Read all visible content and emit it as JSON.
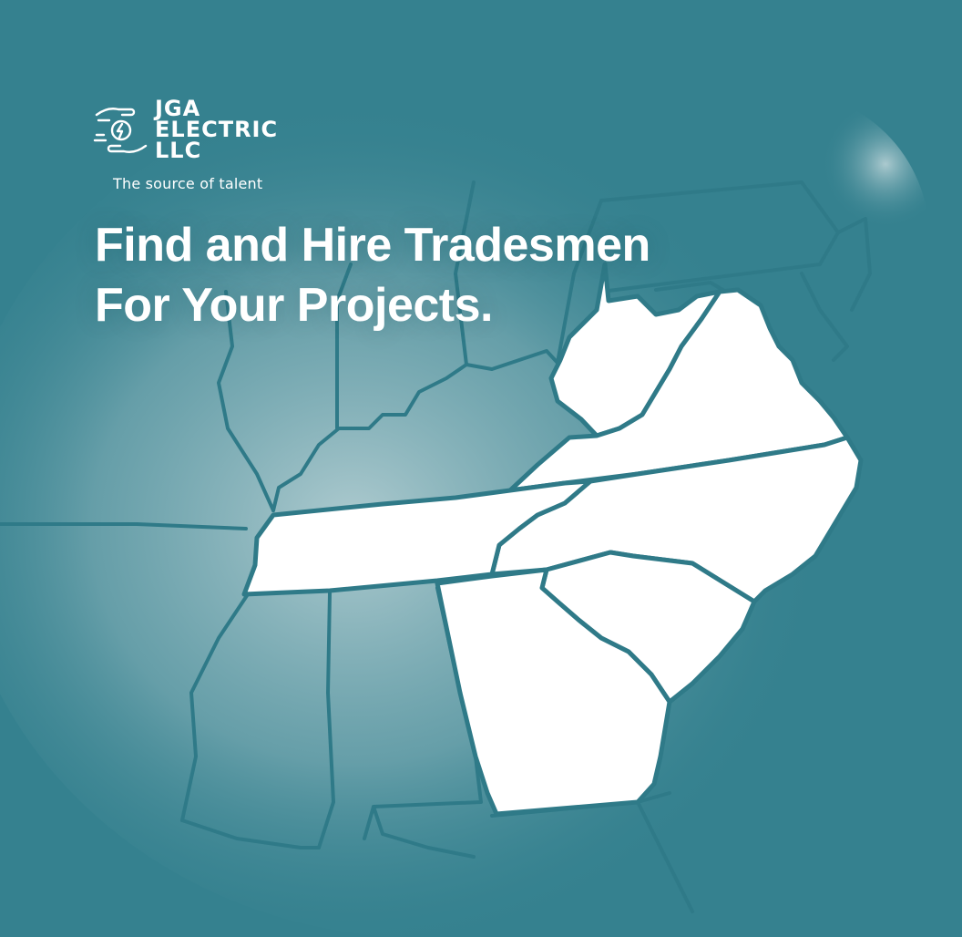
{
  "brand": {
    "name_lines": [
      "JGA",
      "ELECTRIC",
      "LLC"
    ],
    "tagline": "The source of talent",
    "logo_icon": "hands-lightning-icon"
  },
  "headline": {
    "line1": "Find and Hire Tradesmen",
    "line2": "For Your Projects."
  },
  "map": {
    "description_icon": "southeast-us-states-map",
    "highlighted_states": [
      "west-virginia",
      "virginia",
      "tennessee",
      "north-carolina",
      "south-carolina",
      "georgia"
    ]
  },
  "colors": {
    "background": "#35818f",
    "glow": "#a9c6cb",
    "state_fill": "#ffffff",
    "border": "#2f7a88"
  }
}
